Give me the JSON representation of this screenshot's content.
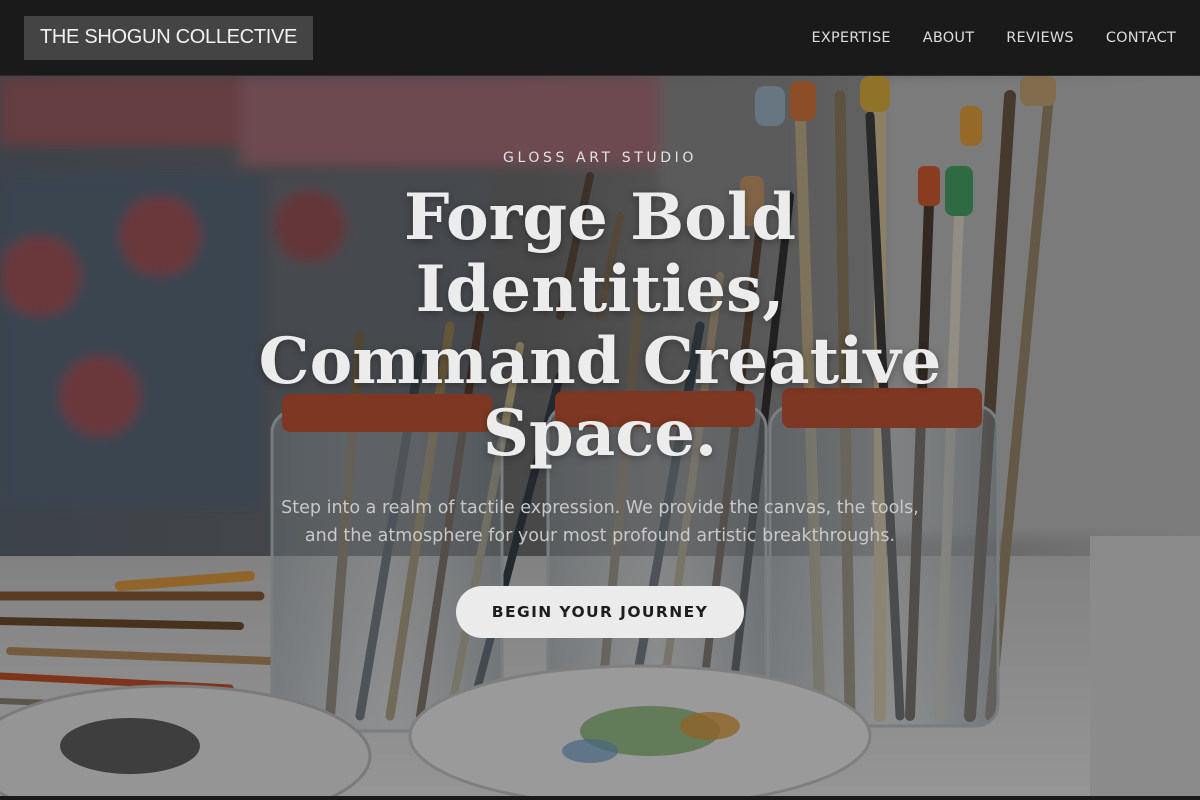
{
  "header": {
    "brand": "THE SHOGUN COLLECTIVE",
    "nav": [
      {
        "label": "EXPERTISE"
      },
      {
        "label": "ABOUT"
      },
      {
        "label": "REVIEWS"
      },
      {
        "label": "CONTACT"
      }
    ]
  },
  "hero": {
    "eyebrow": "GLOSS ART STUDIO",
    "headline_lines": [
      "Forge Bold Identities,",
      "Command Creative",
      "Space."
    ],
    "tagline": "Step into a realm of tactile expression. We provide the canvas, the tools, and the atmosphere for your most profound artistic breakthroughs.",
    "cta_label": "BEGIN YOUR JOURNEY",
    "background_image": "art-studio-paintbrush-jars-photo"
  },
  "colors": {
    "nav_background": "#1a1a1a",
    "brand_background": "#444444",
    "cta_background": "#ebebeb",
    "cta_text": "#1d1d1d"
  }
}
